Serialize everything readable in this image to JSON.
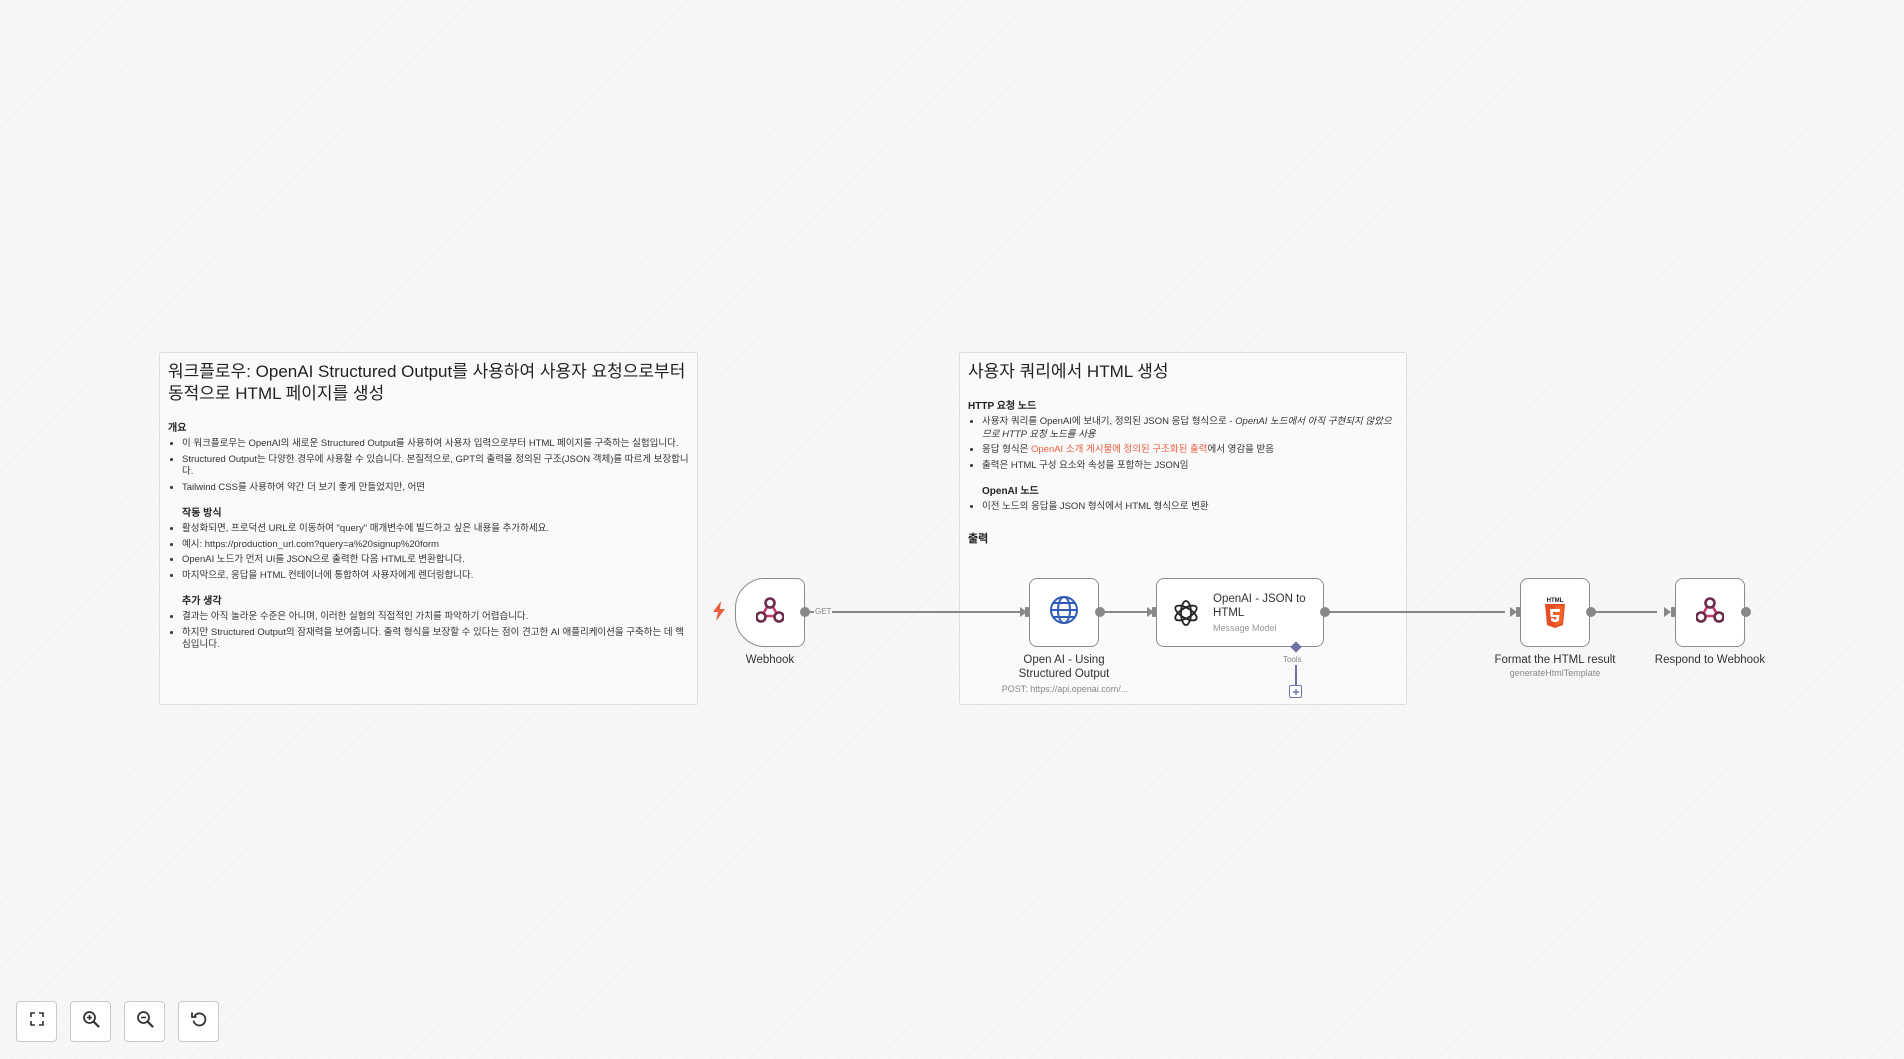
{
  "note_left": {
    "title": "워크플로우: OpenAI Structured Output를 사용하여 사용자 요청으로부터 동적으로 HTML 페이지를 생성",
    "overview_heading": "개요",
    "overview_items": [
      "이 워크플로우는 OpenAI의 새로운 Structured Output를 사용하여 사용자 입력으로부터 HTML 페이지를 구축하는 실험입니다.",
      "Structured Output는 다양한 경우에 사용할 수 있습니다. 본질적으로, GPT의 출력을 정의된 구조(JSON 객체)를 따르게 보장합니다.",
      "Tailwind CSS를 사용하여 약간 더 보기 좋게 만들었지만, 어떤"
    ],
    "how_heading": "작동 방식",
    "how_items": [
      "활성화되면, 프로덕션 URL로 이동하여 \"query\" 매개변수에 빌드하고 싶은 내용을 추가하세요.",
      "예시: https://production_url.com?query=a%20signup%20form",
      "OpenAI 노드가 먼저 UI를 JSON으로 출력한 다음 HTML로 변환합니다.",
      "마지막으로, 응답을 HTML 컨테이너에 통합하여 사용자에게 렌더링합니다."
    ],
    "more_heading": "추가 생각",
    "more_items": [
      "결과는 아직 놀라운 수준은 아니며, 이러한 실험의 직접적인 가치를 파악하기 어렵습니다.",
      "하지만 Structured Output의 잠재력을 보여줍니다. 출력 형식을 보장할 수 있다는 점이 견고한 AI 애플리케이션을 구축하는 데 핵심입니다."
    ]
  },
  "note_right": {
    "title": "사용자 쿼리에서 HTML 생성",
    "http_heading": "HTTP 요청 노드",
    "http_item1_a": "사용자 쿼리를 OpenAI에 보내기, 정의된 JSON 응답 형식으로 - ",
    "http_item1_b": "OpenAI 노드에서 아직 구현되지 않았으므로 HTTP 요청 노드를 사용",
    "http_item2_a": "응답 형식은 ",
    "http_item2_link": "OpenAI 소개 게시물에 정의된 구조화된 출력",
    "http_item2_b": "에서 영감을 받음",
    "http_item3": "출력은 HTML 구성 요소와 속성을 포함하는 JSON임",
    "openai_heading": "OpenAI 노드",
    "openai_item1": "이전 노드의 응답을 JSON 형식에서 HTML 형식으로 변환",
    "output_heading": "출력"
  },
  "nodes": {
    "webhook": {
      "label": "Webhook",
      "edge_label": "GET"
    },
    "http": {
      "label_line1": "Open AI - Using",
      "label_line2": "Structured Output",
      "sub": "POST: https://api.openai.com/..."
    },
    "openai": {
      "label": "OpenAI - JSON to HTML",
      "sub": "Message Model",
      "tools_label": "Tools"
    },
    "format": {
      "label": "Format the HTML result",
      "sub": "generateHtmlTemplate",
      "badge": "HTML"
    },
    "respond": {
      "label": "Respond to Webhook"
    }
  },
  "colors": {
    "accent_red": "#ea5f3e",
    "webhook_pink": "#c7386b",
    "http_blue": "#2f5ab5",
    "html_orange": "#e54d26",
    "tool_purple": "#6e72a8"
  },
  "controls": [
    {
      "name": "fit-view-button",
      "icon": "fullscreen-icon"
    },
    {
      "name": "zoom-in-button",
      "icon": "zoom-in-icon"
    },
    {
      "name": "zoom-out-button",
      "icon": "zoom-out-icon"
    },
    {
      "name": "reset-zoom-button",
      "icon": "reset-icon"
    }
  ]
}
